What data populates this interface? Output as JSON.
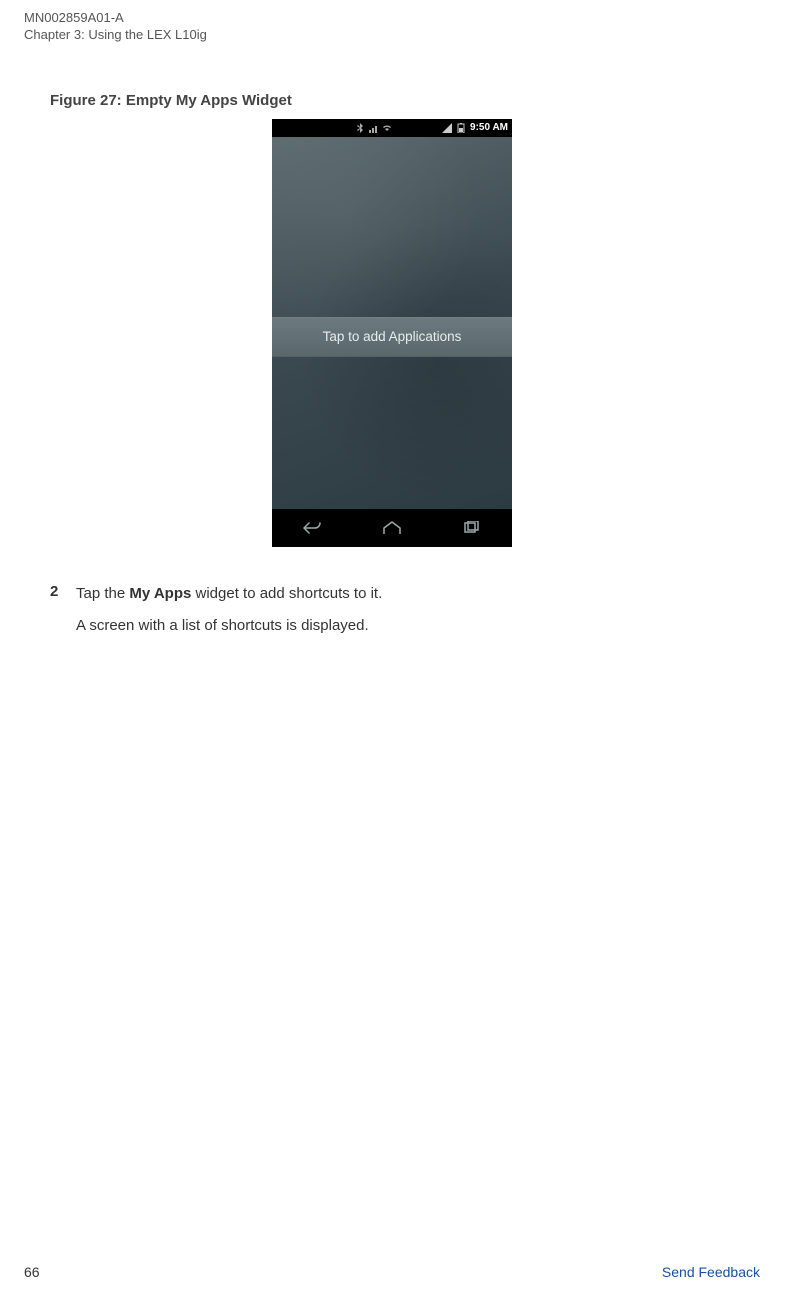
{
  "header": {
    "doc_id": "MN002859A01-A",
    "chapter": "Chapter 3:  Using the LEX L10ig"
  },
  "figure": {
    "caption": "Figure 27: Empty My Apps Widget"
  },
  "phone": {
    "status_time": "9:50 AM",
    "widget_text": "Tap to add Applications"
  },
  "step": {
    "number": "2",
    "line1_prefix": "Tap the ",
    "line1_bold": "My Apps",
    "line1_suffix": " widget to add shortcuts to it.",
    "line2": "A screen with a list of shortcuts is displayed."
  },
  "footer": {
    "page": "66",
    "feedback": "Send Feedback"
  }
}
